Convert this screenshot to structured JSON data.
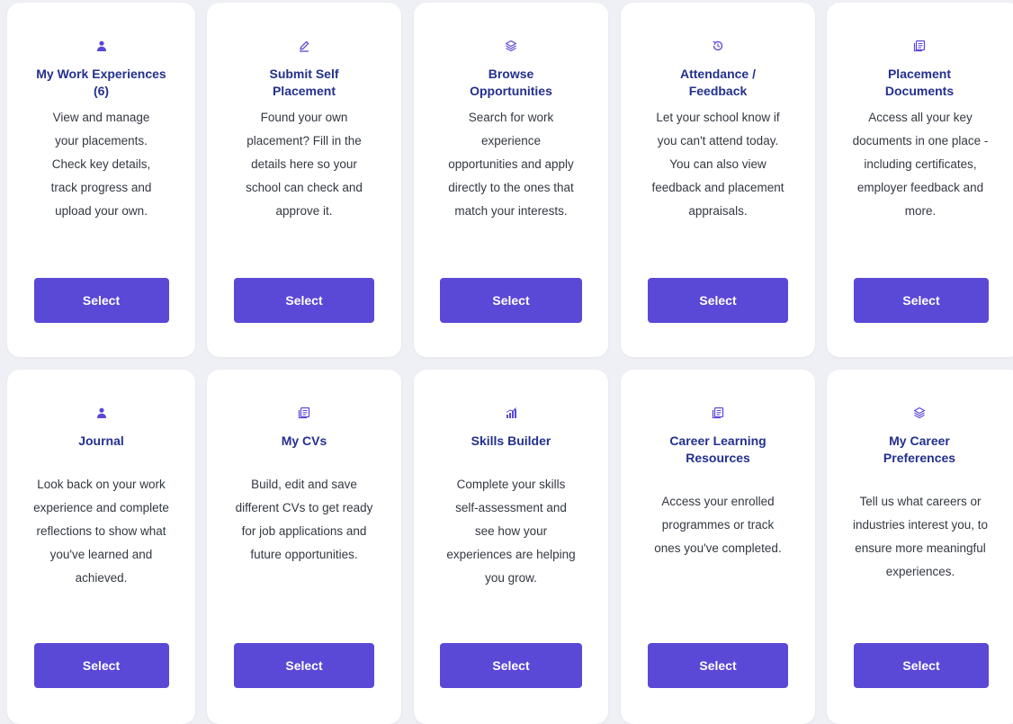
{
  "cards": [
    {
      "title": "My Work Experiences (6)",
      "description": "View and manage your placements. Check key details, track progress and upload your own.",
      "button": "Select",
      "icon": "person-icon"
    },
    {
      "title": "Submit Self Placement",
      "description": "Found your own placement? Fill in the details here so your school can check and approve it.",
      "button": "Select",
      "icon": "pencil-icon"
    },
    {
      "title": "Browse Opportunities",
      "description": "Search for work experience opportunities and apply directly to the ones that match your interests.",
      "button": "Select",
      "icon": "layers-icon"
    },
    {
      "title": "Attendance / Feedback",
      "description": "Let your school know if you can't attend today. You can also view feedback and placement appraisals.",
      "button": "Select",
      "icon": "history-icon"
    },
    {
      "title": "Placement Documents",
      "description": "Access all your key documents in one place - including certificates, employer feedback and more.",
      "button": "Select",
      "icon": "documents-icon"
    },
    {
      "title": "Journal",
      "description": "Look back on your work experience and complete reflections to show what you've learned and achieved.",
      "button": "Select",
      "icon": "person-icon"
    },
    {
      "title": "My CVs",
      "description": "Build, edit and save different CVs to get ready for job applications and future opportunities.",
      "button": "Select",
      "icon": "documents-icon"
    },
    {
      "title": "Skills Builder",
      "description": "Complete your skills self-assessment and see how your experiences are helping you grow.",
      "button": "Select",
      "icon": "chart-icon"
    },
    {
      "title": "Career Learning Resources",
      "description": "Access your enrolled programmes or track ones you've completed.",
      "button": "Select",
      "icon": "documents-icon"
    },
    {
      "title": "My Career Preferences",
      "description": "Tell us what careers or industries interest you, to ensure more meaningful experiences.",
      "button": "Select",
      "icon": "layers-icon"
    }
  ],
  "colors": {
    "accent": "#5a48d6",
    "title": "#23308e",
    "background": "#eef0f5"
  }
}
